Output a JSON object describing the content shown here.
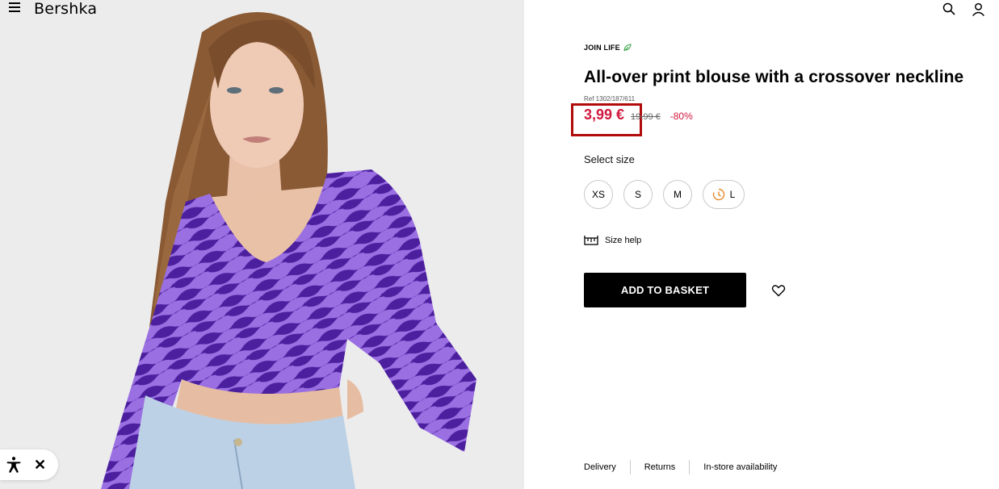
{
  "header": {
    "logo": "Bershka"
  },
  "product": {
    "badge": "JOIN LIFE",
    "title": "All-over print blouse with a crossover neckline",
    "ref": "Ref 1302/187/611",
    "price_now": "3,99 €",
    "price_old": "19,99 €",
    "discount": "-80%",
    "select_size_label": "Select size",
    "sizes": [
      "XS",
      "S",
      "M",
      "L"
    ],
    "size_help": "Size help",
    "add_to_basket": "ADD TO BASKET"
  },
  "footer": {
    "delivery": "Delivery",
    "returns": "Returns",
    "instore": "In-store availability"
  },
  "icons": {
    "menu": "menu-icon",
    "search": "search-icon",
    "account": "user-icon",
    "leaf": "leaf-icon",
    "clock": "clock-icon",
    "ruler": "ruler-icon",
    "heart": "heart-icon",
    "accessibility": "accessibility-icon",
    "close": "close-icon"
  },
  "colors": {
    "price": "#d1193e",
    "button": "#000000",
    "highlight": "#b10b0b",
    "leaf": "#3aa54b",
    "clock": "#e58a2c",
    "garment": "#7a4fd0"
  }
}
